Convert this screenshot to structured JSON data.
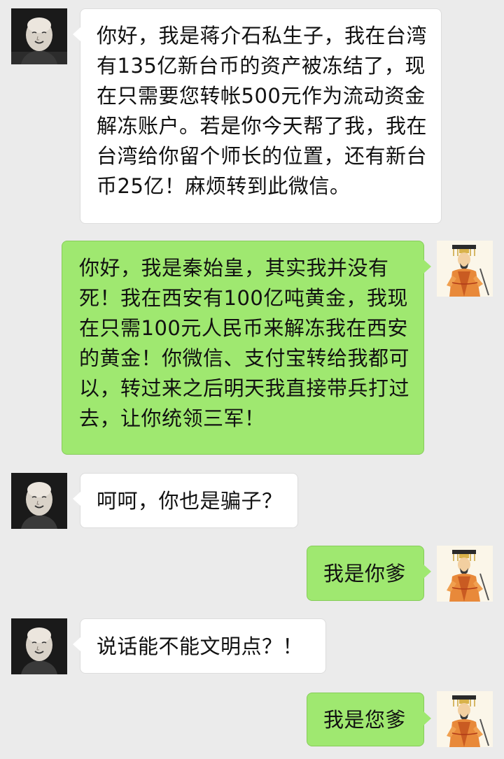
{
  "chat": {
    "messages": [
      {
        "sender": "chiang",
        "side": "left",
        "lines": [
          "你好，我是蒋介石私生子，我在台湾",
          "有135亿新台币的资产被冻结了，现",
          "在只需要您转帐500元作为流动资金",
          "解冻账户。若是你今天帮了我，我在",
          "台湾给你留个师长的位置，还有新台",
          "币25亿！麻烦转到此微信。"
        ]
      },
      {
        "sender": "qin",
        "side": "right",
        "lines": [
          "你好，我是秦始皇，其实我并没有",
          "死！我在西安有100亿吨黄金，我现",
          "在只需100元人民币来解冻我在西安",
          "的黄金！你微信、支付宝转给我都可",
          "以，转过来之后明天我直接带兵打过",
          "去，让你统领三军！"
        ]
      },
      {
        "sender": "chiang",
        "side": "left",
        "lines": [
          "呵呵，你也是骗子？"
        ]
      },
      {
        "sender": "qin",
        "side": "right",
        "lines": [
          "我是你爹"
        ]
      },
      {
        "sender": "chiang",
        "side": "left",
        "lines": [
          "说话能不能文明点？！"
        ]
      },
      {
        "sender": "qin",
        "side": "right",
        "lines": [
          "我是您爹"
        ]
      }
    ]
  },
  "colors": {
    "background": "#ebebeb",
    "bubble_left": "#ffffff",
    "bubble_right": "#9fe870"
  },
  "icons": {
    "left_avatar": "bald-man-portrait-avatar",
    "right_avatar": "emperor-illustration-avatar"
  }
}
